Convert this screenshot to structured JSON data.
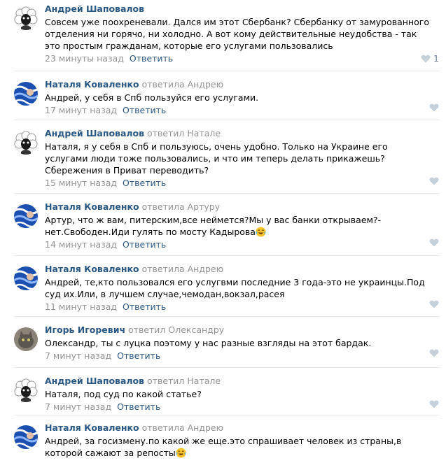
{
  "comments": [
    {
      "author": "Андрей Шаповалов",
      "reply_to": "",
      "text": "Совсем уже поохреневали. Дался им этот Сбербанк? Сбербанку от замурованного отделения ни горячо, ни холодно. А вот кому действительные неудобства - так это простым гражданам, которые его услугами пользовались",
      "time": "23 минуты назад",
      "reply_label": "Ответить",
      "likes": "1",
      "avatar": "white-wig-icon"
    },
    {
      "author": "Наталя Коваленко",
      "reply_to": "ответила Андрею",
      "text": "Андрей, у себя в Спб пользуйся его услугами.",
      "time": "17 минут назад",
      "reply_label": "Ответить",
      "likes": "",
      "avatar": "blue-pattern-icon"
    },
    {
      "author": "Андрей Шаповалов",
      "reply_to": "ответил Натале",
      "text": "Наталя, я у себя в Спб и пользуюсь, очень удобно. Только на Украине его услугами люди тоже пользовались, и что им теперь делать прикажешь? Сбережения в Приват переводить?",
      "time": "15 минут назад",
      "reply_label": "Ответить",
      "likes": "",
      "avatar": "white-wig-icon"
    },
    {
      "author": "Наталя Коваленко",
      "reply_to": "ответила Артуру",
      "text": "Артур, что ж вам, питерским,все неймется?Мы у вас банки открываем?-нет.Свободен.Иди гулять по мосту Кадырова",
      "time": "14 минут назад",
      "reply_label": "Ответить",
      "likes": "",
      "avatar": "blue-pattern-icon"
    },
    {
      "author": "Наталя Коваленко",
      "reply_to": "ответила Андрею",
      "text": "Андрей, те,кто пользовался его услугвми последние 3 года-это не украинцы.Под суд их.Или, в лучшем случае,чемодан,вокзал,расея",
      "time": "11 минут назад",
      "reply_label": "Ответить",
      "likes": "",
      "avatar": "blue-pattern-icon"
    },
    {
      "author": "Игорь Игоревич",
      "reply_to": "ответил Олександру",
      "text": "Олександр, ты с луцка поэтому у нас разные взгляды на этот бардак.",
      "time": "7 минут назад",
      "reply_label": "Ответить",
      "likes": "",
      "avatar": "cat-photo-icon"
    },
    {
      "author": "Андрей Шаповалов",
      "reply_to": "ответил Натале",
      "text": "Наталя, под суд по какой статье?",
      "time": "7 минут назад",
      "reply_label": "Ответить",
      "likes": "",
      "avatar": "white-wig-icon"
    },
    {
      "author": "Наталя Коваленко",
      "reply_to": "ответила Андрею",
      "text": "Андрей, за госизмену.по какой же еще.это спрашивает человек из страны,в которой сажают за репосты",
      "time": "",
      "reply_label": "",
      "likes": "",
      "avatar": "blue-pattern-icon"
    }
  ],
  "colors": {
    "link": "#2a5885",
    "muted": "#939393",
    "separator": "#e7e8ec",
    "like_icon": "#c5d0db"
  }
}
